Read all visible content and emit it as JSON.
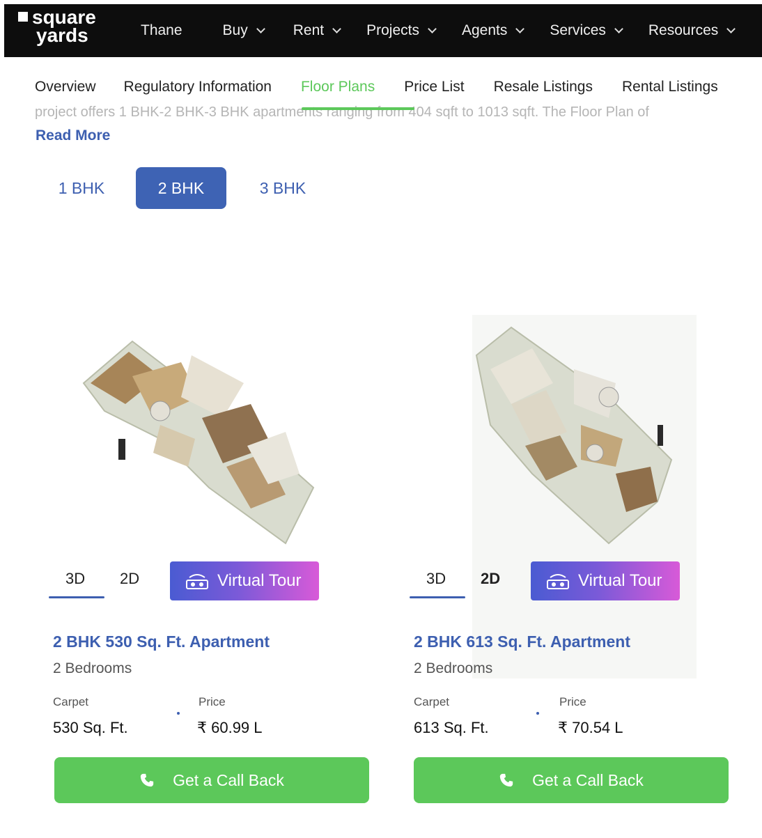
{
  "brand": {
    "line1": "square",
    "line2": "yards"
  },
  "nav": {
    "items": [
      {
        "label": "Thane",
        "dropdown": false
      },
      {
        "label": "Buy",
        "dropdown": true
      },
      {
        "label": "Rent",
        "dropdown": true
      },
      {
        "label": "Projects",
        "dropdown": true
      },
      {
        "label": "Agents",
        "dropdown": true
      },
      {
        "label": "Services",
        "dropdown": true
      },
      {
        "label": "Resources",
        "dropdown": true
      }
    ]
  },
  "tabs": {
    "items": [
      "Overview",
      "Regulatory Information",
      "Floor Plans",
      "Price List",
      "Resale Listings",
      "Rental Listings"
    ],
    "active": "Floor Plans"
  },
  "description": {
    "text": "project offers 1 BHK-2 BHK-3 BHK apartments ranging from 404 sqft to 1013 sqft. The Floor Plan of",
    "read_more": "Read More"
  },
  "bhk_tabs": {
    "items": [
      "1 BHK",
      "2 BHK",
      "3 BHK"
    ],
    "active": "2 BHK"
  },
  "cards": [
    {
      "title": "2 BHK 530 Sq. Ft. Apartment",
      "bedrooms": "2 Bedrooms",
      "view_3d": "3D",
      "view_2d": "2D",
      "virtual_tour": "Virtual Tour",
      "carpet_label": "Carpet",
      "carpet_value": "530 Sq. Ft.",
      "price_label": "Price",
      "price_value": "₹ 60.99 L",
      "cta": "Get a Call Back"
    },
    {
      "title": "2 BHK 613 Sq. Ft. Apartment",
      "bedrooms": "2 Bedrooms",
      "view_3d": "3D",
      "view_2d": "2D",
      "virtual_tour": "Virtual Tour",
      "carpet_label": "Carpet",
      "carpet_value": "613 Sq. Ft.",
      "price_label": "Price",
      "price_value": "₹ 70.54 L",
      "cta": "Get a Call Back"
    }
  ],
  "colors": {
    "accent_green": "#5cc85a",
    "accent_blue": "#3d5fb0",
    "nav_bg": "#0d0d0d"
  }
}
